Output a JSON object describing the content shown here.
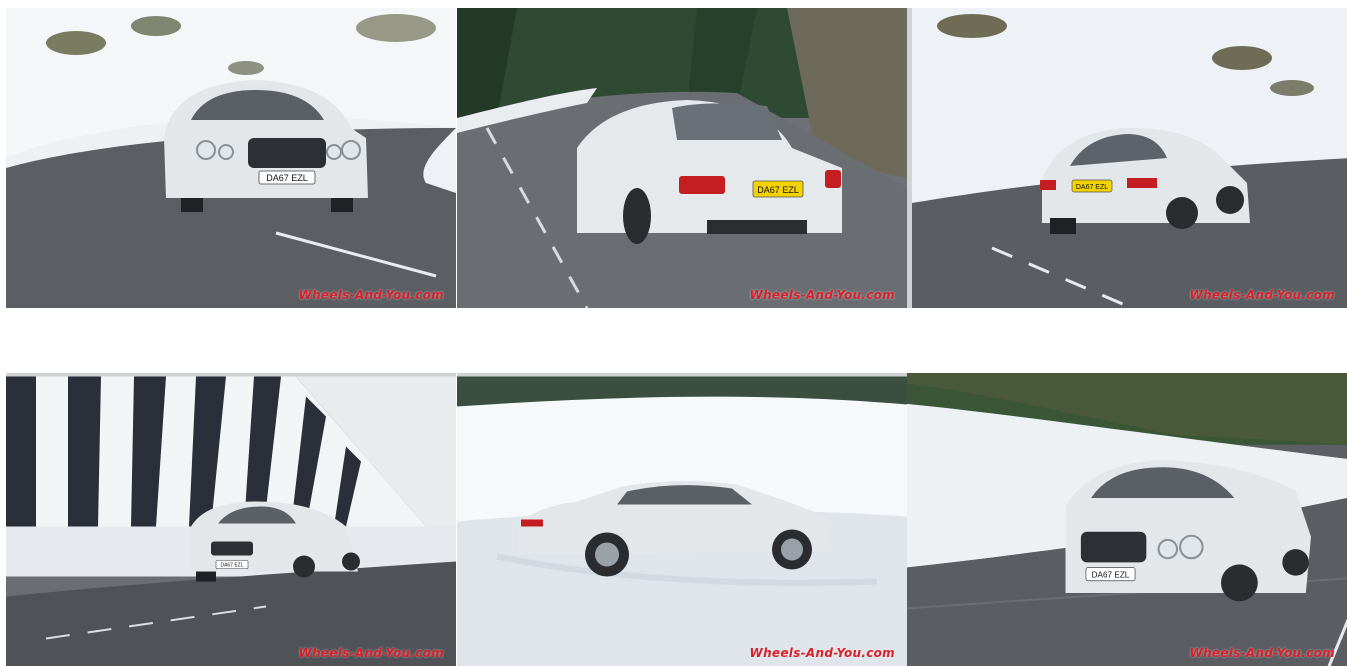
{
  "gallery": {
    "watermark": "Wheels-And-You.com",
    "tiles": [
      {
        "plate": "DA67 EZL",
        "plate_color": "#ffffff"
      },
      {
        "plate": "DA67 EZL",
        "plate_color": "#f2d200"
      },
      {
        "plate": "DA67 EZL",
        "plate_color": "#f2d200"
      },
      {
        "plate": "DA67 EZL",
        "plate_color": "#ffffff"
      },
      {
        "plate": "",
        "plate_color": ""
      },
      {
        "plate": "DA67 EZL",
        "plate_color": "#ffffff"
      }
    ]
  },
  "colors": {
    "watermark": "#d8202a",
    "snow": "#eef2f6",
    "road": "#5b5f63",
    "car": "#e6e9ec",
    "trees": "#2d4a2e"
  }
}
